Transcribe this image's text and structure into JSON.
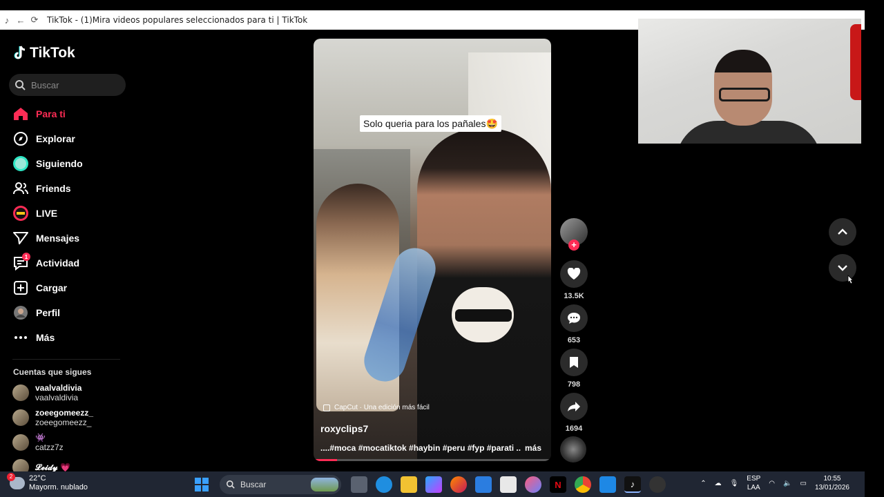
{
  "browser": {
    "tab_title": "TikTok - (1)Mira videos populares seleccionados para ti | TikTok"
  },
  "sidebar": {
    "logo_text": "TikTok",
    "search_placeholder": "Buscar",
    "nav": [
      {
        "label": "Para ti",
        "icon": "home-icon",
        "active": true
      },
      {
        "label": "Explorar",
        "icon": "compass-icon"
      },
      {
        "label": "Siguiendo",
        "icon": "following-icon"
      },
      {
        "label": "Friends",
        "icon": "friends-icon"
      },
      {
        "label": "LIVE",
        "icon": "live-icon"
      },
      {
        "label": "Mensajes",
        "icon": "messages-icon"
      },
      {
        "label": "Actividad",
        "icon": "activity-icon",
        "badge": "1"
      },
      {
        "label": "Cargar",
        "icon": "upload-icon"
      },
      {
        "label": "Perfil",
        "icon": "profile-avatar"
      },
      {
        "label": "Más",
        "icon": "more-icon"
      }
    ],
    "following_header": "Cuentas que sigues",
    "following": [
      {
        "name": "vaalvaldivia",
        "handle": "vaalvaldivia"
      },
      {
        "name": "zoeegomeezz_",
        "handle": "zoeegomeezz_"
      },
      {
        "name": "👾",
        "handle": "catzz7z"
      },
      {
        "name": "𝓛𝓮𝓲𝓭𝔂 💗",
        "handle": ""
      }
    ]
  },
  "video": {
    "caption_overlay": "Solo queria para los pañales🤩",
    "capcut_label": "CapCut · Una edición más fácil",
    "username": "roxyclips7",
    "tags": "....#moca #mocatiktok #haybin #peru #fyp #parati ...",
    "more_label": "más",
    "progress": 0.1
  },
  "actions": {
    "likes": "13.5K",
    "comments": "653",
    "saves": "798",
    "shares": "1694"
  },
  "taskbar": {
    "temperature": "22°C",
    "weather_desc": "Mayorm. nublado",
    "weather_badge": "2",
    "search_label": "Buscar",
    "lang_line1": "ESP",
    "lang_line2": "LAA",
    "time": "10:55",
    "date": "13/01/2026"
  }
}
